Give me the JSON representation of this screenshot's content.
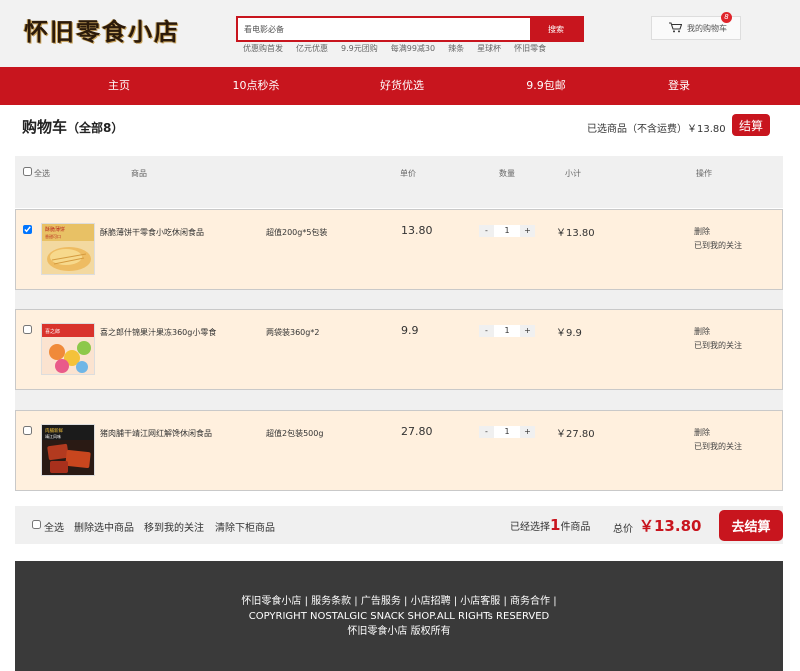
{
  "header": {
    "logo": "怀旧零食小店",
    "search_placeholder": "看电影必备",
    "search_button": "搜索",
    "hot_links": [
      "优惠购首发",
      "亿元优惠",
      "9.9元团购",
      "每满99减30",
      "辣条",
      "星球杯",
      "怀旧零食"
    ],
    "cart_label": "我的购物车",
    "cart_badge": "8"
  },
  "nav": {
    "items": [
      "主页",
      "10点秒杀",
      "好货优选",
      "9.9包邮",
      "登录"
    ]
  },
  "cart": {
    "title": "购物车",
    "count_label": "（全部8）",
    "selected_info": "已选商品（不含运费）￥13.80",
    "checkout_label": "结算"
  },
  "table_header": {
    "select_all": "全选",
    "product": "商品",
    "unit_price": "单价",
    "quantity": "数量",
    "subtotal": "小计",
    "operation": "操作"
  },
  "items": [
    {
      "name": "酥脆薄饼干零食小吃休闲食品",
      "spec": "超值200g*5包装",
      "price": "13.80",
      "qty": "1",
      "subtotal": "￥13.80",
      "op_delete": "删除",
      "op_follow": "已到我的关注",
      "checked": true
    },
    {
      "name": "喜之郎什锦果汁果冻360g小零食",
      "spec": "两袋装360g*2",
      "price": "9.9",
      "qty": "1",
      "subtotal": "￥9.9",
      "op_delete": "删除",
      "op_follow": "已到我的关注",
      "checked": false
    },
    {
      "name": "猪肉脯干靖江网红解馋休闲食品",
      "spec": "超值2包装500g",
      "price": "27.80",
      "qty": "1",
      "subtotal": "￥27.80",
      "op_delete": "删除",
      "op_follow": "已到我的关注",
      "checked": false
    }
  ],
  "qty_controls": {
    "minus": "-",
    "plus": "+"
  },
  "footer_bar": {
    "select_all": "全选",
    "delete_selected": "删除选中商品",
    "move_to_follow": "移到我的关注",
    "clear_items": "清除下柜商品",
    "selected_prefix": "已经选择",
    "selected_count": "1",
    "selected_suffix": "件商品",
    "total_label": "总价",
    "total_value": "￥13.80",
    "checkout_label": "去结算"
  },
  "site_footer": {
    "line1": "怀旧零食小店 | 服务条款 | 广告服务 | 小店招聘 | 小店客服 | 商务合作 |",
    "line2": "COPYRIGHT NOSTALGIC SNACK SHOP.ALL RIGHTs RESERVED",
    "line3": "怀旧零食小店 版权所有"
  },
  "colors": {
    "brand_red": "#c8151e",
    "row_bg": "#fff0de",
    "footer_bg": "#3a3a3a"
  }
}
